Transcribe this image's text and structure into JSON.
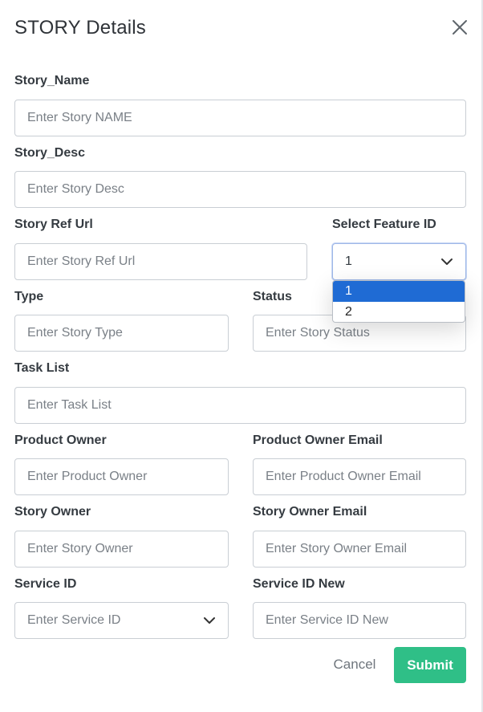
{
  "modal": {
    "title": "STORY Details"
  },
  "fields": {
    "story_name": {
      "label": "Story_Name",
      "placeholder": "Enter Story NAME"
    },
    "story_desc": {
      "label": "Story_Desc",
      "placeholder": "Enter Story Desc"
    },
    "story_ref_url": {
      "label": "Story Ref Url",
      "placeholder": "Enter Story Ref Url"
    },
    "feature_id": {
      "label": "Select Feature ID",
      "value": "1",
      "options": [
        "1",
        "2"
      ],
      "selected_option": "1"
    },
    "type": {
      "label": "Type",
      "placeholder": "Enter Story Type"
    },
    "status": {
      "label": "Status",
      "placeholder": "Enter Story Status"
    },
    "task_list": {
      "label": "Task List",
      "placeholder": "Enter Task List"
    },
    "product_owner": {
      "label": "Product Owner",
      "placeholder": "Enter Product Owner"
    },
    "product_owner_email": {
      "label": "Product Owner Email",
      "placeholder": "Enter Product Owner Email"
    },
    "story_owner": {
      "label": "Story Owner",
      "placeholder": "Enter Story Owner"
    },
    "story_owner_email": {
      "label": "Story Owner Email",
      "placeholder": "Enter Story Owner Email"
    },
    "service_id": {
      "label": "Service ID",
      "placeholder": "Enter Service ID"
    },
    "service_id_new": {
      "label": "Service ID New",
      "placeholder": "Enter Service ID New"
    }
  },
  "actions": {
    "cancel_label": "Cancel",
    "submit_label": "Submit"
  },
  "colors": {
    "submit_bg": "#2fbf87",
    "dropdown_selected_bg": "#1f6bd4",
    "input_border": "#c9ced4"
  },
  "icons": {
    "close": "close-icon",
    "chevron": "chevron-down-icon"
  }
}
